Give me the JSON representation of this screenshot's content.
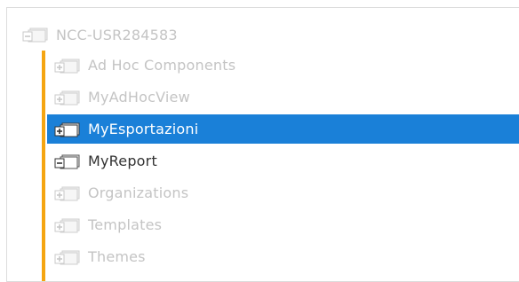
{
  "tree": {
    "root": {
      "label": "NCC-USR284583",
      "expanded": true,
      "state": "faded"
    },
    "items": [
      {
        "label": "Ad Hoc Components",
        "expanded": false,
        "state": "faded"
      },
      {
        "label": "MyAdHocView",
        "expanded": false,
        "state": "faded"
      },
      {
        "label": "MyEsportazioni",
        "expanded": false,
        "state": "selected"
      },
      {
        "label": "MyReport",
        "expanded": true,
        "state": "normal"
      },
      {
        "label": "Organizations",
        "expanded": false,
        "state": "faded"
      },
      {
        "label": "Templates",
        "expanded": false,
        "state": "faded"
      },
      {
        "label": "Themes",
        "expanded": false,
        "state": "faded"
      }
    ]
  },
  "colors": {
    "selection": "#1a80d8",
    "guide": "#f5a511",
    "faded_text": "#c4c4c4",
    "normal_text": "#333333"
  },
  "icons": {
    "collapsed": "plus-box-folder-icon",
    "expanded": "minus-box-folder-icon"
  }
}
